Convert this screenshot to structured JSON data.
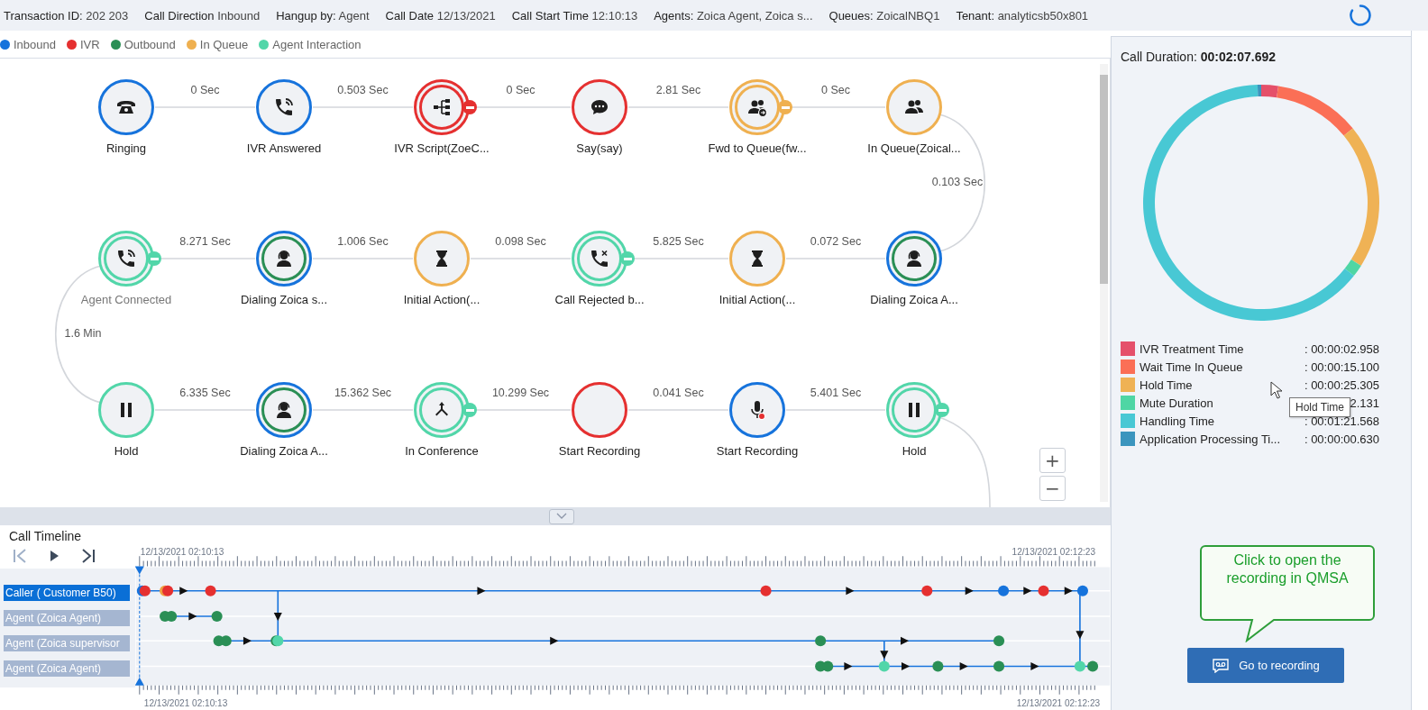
{
  "header": {
    "items": [
      {
        "label": "Transaction ID:",
        "value": "202 203"
      },
      {
        "label": "Call Direction",
        "value": "Inbound"
      },
      {
        "label": "Hangup by:",
        "value": "Agent"
      },
      {
        "label": "Call Date",
        "value": "12/13/2021"
      },
      {
        "label": "Call Start Time",
        "value": "12:10:13"
      },
      {
        "label": "Agents:",
        "value": "Zoica Agent, Zoica s..."
      },
      {
        "label": "Queues:",
        "value": "ZoicalNBQ1"
      },
      {
        "label": "Tenant:",
        "value": "analyticsb50x801"
      }
    ]
  },
  "legend": [
    {
      "label": "Inbound",
      "color": "#1673dc"
    },
    {
      "label": "IVR",
      "color": "#e53030"
    },
    {
      "label": "Outbound",
      "color": "#2a8f55"
    },
    {
      "label": "In Queue",
      "color": "#efb050"
    },
    {
      "label": "Agent Interaction",
      "color": "#52d6a9"
    }
  ],
  "flow": {
    "nodes": [
      {
        "label": "Ringing",
        "kind": "telephone",
        "rings": [
          {
            "color": "#1673dc"
          }
        ],
        "badge": false,
        "dimmed": false
      },
      {
        "label": "IVR Answered",
        "kind": "call",
        "rings": [
          {
            "color": "#1673dc"
          }
        ],
        "badge": false,
        "dimmed": false,
        "edge_label": "0 Sec"
      },
      {
        "label": "IVR Script(ZoeC...",
        "kind": "tree",
        "rings": [
          {
            "color": "#e53030"
          },
          {
            "color": "#e53030"
          }
        ],
        "badge": true,
        "dimmed": false,
        "edge_label": "0.503 Sec"
      },
      {
        "label": "Say(say)",
        "kind": "chat",
        "rings": [
          {
            "color": "#e53030"
          }
        ],
        "badge": false,
        "dimmed": false,
        "edge_label": "0 Sec"
      },
      {
        "label": "Fwd to Queue(fw...",
        "kind": "queue-forward",
        "rings": [
          {
            "color": "#efb050"
          },
          {
            "color": "#efb050"
          }
        ],
        "badge": true,
        "dimmed": false,
        "edge_label": "2.81 Sec"
      },
      {
        "label": "In Queue(Zoical...",
        "kind": "queue",
        "rings": [
          {
            "color": "#efb050"
          }
        ],
        "badge": false,
        "dimmed": false,
        "edge_label": "0 Sec"
      },
      {
        "label": "Agent Connected",
        "kind": "call",
        "rings": [
          {
            "color": "#52d6a9"
          },
          {
            "color": "#52d6a9"
          }
        ],
        "badge": true,
        "dimmed": true
      },
      {
        "label": "Dialing Zoica s...",
        "kind": "agent",
        "rings": [
          {
            "color": "#1673dc"
          },
          {
            "color": "#2a8f55"
          }
        ],
        "badge": false,
        "dimmed": false,
        "edge_label": "8.271 Sec"
      },
      {
        "label": "Initial Action(...",
        "kind": "hourglass",
        "rings": [
          {
            "color": "#efb050"
          }
        ],
        "badge": false,
        "dimmed": false,
        "edge_label": "1.006 Sec"
      },
      {
        "label": "Call Rejected b...",
        "kind": "call-rejected",
        "rings": [
          {
            "color": "#52d6a9"
          },
          {
            "color": "#52d6a9"
          }
        ],
        "badge": true,
        "dimmed": false,
        "edge_label": "0.098 Sec"
      },
      {
        "label": "Initial Action(...",
        "kind": "hourglass",
        "rings": [
          {
            "color": "#efb050"
          }
        ],
        "badge": false,
        "dimmed": false,
        "edge_label": "5.825 Sec"
      },
      {
        "label": "Dialing Zoica A...",
        "kind": "agent",
        "rings": [
          {
            "color": "#1673dc"
          },
          {
            "color": "#2a8f55"
          }
        ],
        "badge": false,
        "dimmed": false,
        "edge_label": "0.072 Sec"
      },
      {
        "label": "Hold",
        "kind": "pause",
        "rings": [
          {
            "color": "#52d6a9"
          }
        ],
        "badge": false,
        "dimmed": false
      },
      {
        "label": "Dialing Zoica A...",
        "kind": "agent",
        "rings": [
          {
            "color": "#1673dc"
          },
          {
            "color": "#2a8f55"
          }
        ],
        "badge": false,
        "dimmed": false,
        "edge_label": "6.335 Sec"
      },
      {
        "label": "In Conference",
        "kind": "conference",
        "rings": [
          {
            "color": "#52d6a9"
          },
          {
            "color": "#52d6a9"
          }
        ],
        "badge": true,
        "dimmed": false,
        "edge_label": "15.362 Sec"
      },
      {
        "label": "Start Recording",
        "kind": "blank",
        "rings": [
          {
            "color": "#e53030"
          }
        ],
        "badge": false,
        "dimmed": false,
        "edge_label": "10.299 Sec"
      },
      {
        "label": "Start Recording",
        "kind": "mic",
        "rings": [
          {
            "color": "#1673dc"
          }
        ],
        "badge": false,
        "dimmed": false,
        "edge_label": "0.041 Sec"
      },
      {
        "label": "Hold",
        "kind": "pause",
        "rings": [
          {
            "color": "#52d6a9"
          },
          {
            "color": "#52d6a9"
          }
        ],
        "badge": true,
        "dimmed": false,
        "edge_label": "5.401 Sec"
      }
    ],
    "curve_labels": [
      "0.103 Sec",
      "1.6 Min"
    ],
    "zoom_controls": [
      "+",
      "−"
    ]
  },
  "timeline": {
    "title": "Call Timeline",
    "controls": [
      {
        "kind": "first",
        "disabled": true
      },
      {
        "kind": "play",
        "disabled": false
      },
      {
        "kind": "last",
        "disabled": false
      }
    ],
    "start_label": "12/13/2021 02:10:13",
    "end_label": "12/13/2021 02:12:23",
    "bottom_start_label": "12/13/2021 02:10:13",
    "bottom_end_label": "12/13/2021 02:12:23",
    "lanes": [
      {
        "label": "Caller ( Customer B50)",
        "selected": true
      },
      {
        "label": "Agent (Zoica Agent)",
        "selected": false
      },
      {
        "label": "Agent (Zoica supervisor",
        "selected": false
      },
      {
        "label": "Agent (Zoica Agent)",
        "selected": false
      }
    ]
  },
  "summary": {
    "title": "Call Duration:",
    "total": "00:02:07.692",
    "chart_data": {
      "type": "donut",
      "values": [
        2.317,
        11.825,
        19.817,
        1.669,
        63.879,
        0.493
      ]
    },
    "items": [
      {
        "label": "IVR Treatment Time",
        "value": ": 00:00:02.958",
        "color": "#e5506a"
      },
      {
        "label": "Wait Time In Queue",
        "value": ": 00:00:15.100",
        "color": "#fb6f56"
      },
      {
        "label": "Hold Time",
        "value": ": 00:00:25.305",
        "color": "#efb255"
      },
      {
        "label": "Mute Duration",
        "value": "2.131",
        "color": "#4fd6a4"
      },
      {
        "label": "Handling Time",
        "value": ": 00:01:21.568",
        "color": "#48c8d4"
      },
      {
        "label": "Application Processing Ti...",
        "value": ": 00:00:00.630",
        "color": "#3b95be"
      }
    ],
    "tooltip": "Hold Time",
    "callout": "Click to open the recording in QMSA",
    "button": "Go to recording"
  }
}
